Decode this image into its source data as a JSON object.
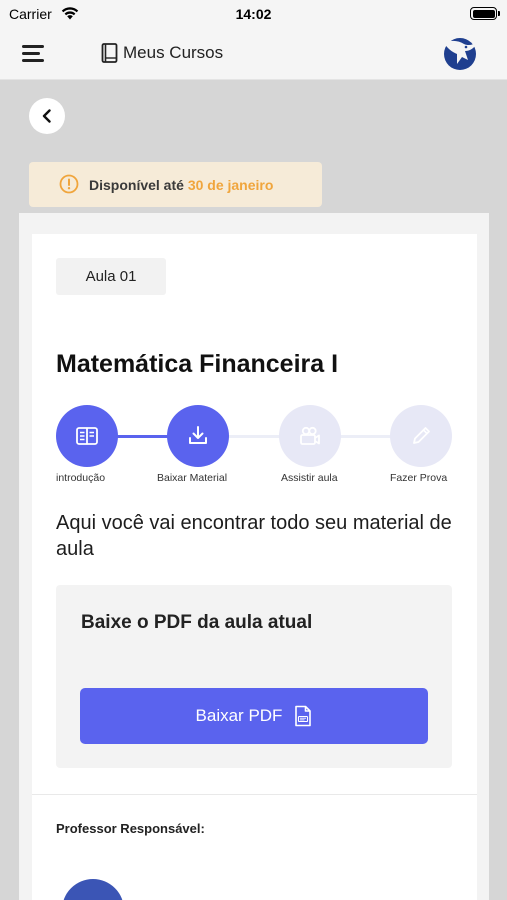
{
  "status_bar": {
    "carrier": "Carrier",
    "time": "14:02"
  },
  "header": {
    "title": "Meus Cursos",
    "menu_icon": "hamburger-menu-icon",
    "title_icon": "book-icon",
    "logo_icon": "brand-logo-icon"
  },
  "back": {
    "icon": "chevron-left-icon"
  },
  "availability": {
    "prefix": "Disponível até",
    "date": "30 de janeiro",
    "icon": "warning-circle-icon"
  },
  "lesson": {
    "badge": "Aula 01",
    "title": "Matemática Financeira I"
  },
  "steps": [
    {
      "label": "introdução",
      "icon": "book-open-icon",
      "state": "done"
    },
    {
      "label": "Baixar Material",
      "icon": "download-icon",
      "state": "current"
    },
    {
      "label": "Assistir aula",
      "icon": "video-camera-icon",
      "state": "pending"
    },
    {
      "label": "Fazer Prova",
      "icon": "pencil-icon",
      "state": "pending"
    }
  ],
  "description": "Aqui você vai encontrar todo seu material de aula",
  "pdf": {
    "heading": "Baixe o PDF da aula atual",
    "button_label": "Baixar PDF",
    "button_icon": "pdf-file-icon"
  },
  "professor": {
    "label": "Professor Responsável:"
  },
  "colors": {
    "accent": "#5a63ee",
    "accent_inactive": "#e7e8f6",
    "warning_bg": "#f6ebd8",
    "warning": "#f0a53c",
    "logo": "#1f3f8f"
  }
}
